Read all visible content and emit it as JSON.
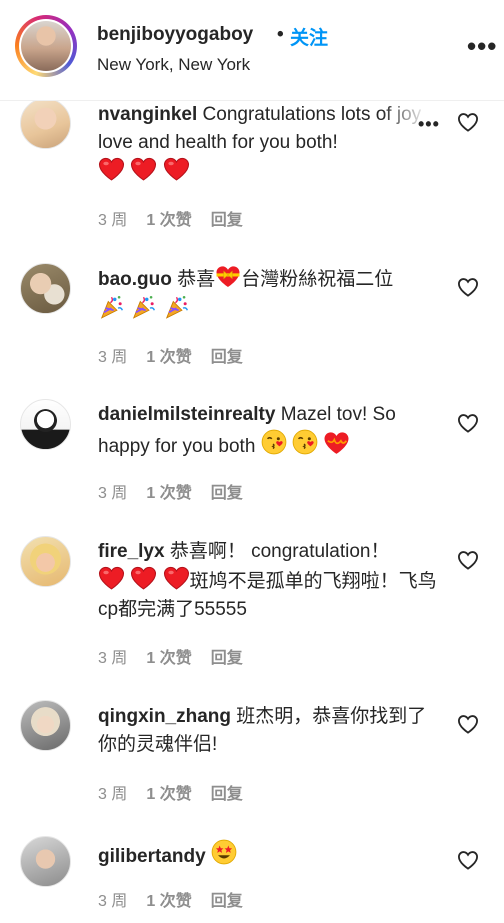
{
  "header": {
    "username": "benjiboyyogaboy",
    "dot": "•",
    "follow_label": "关注",
    "location": "New York, New York",
    "more_icon": "more-horizontal-icon"
  },
  "colors": {
    "follow": "#0095f6",
    "meta": "#8e8e8e",
    "heart_red": "#ed1c24"
  },
  "comments": [
    {
      "username": "nvanginkel",
      "text": "Congratulations lots of joy love and health for you both!",
      "emoji": [
        "red-heart",
        "red-heart",
        "red-heart"
      ],
      "age": "3 周",
      "likes": "1 次赞",
      "reply": "回复"
    },
    {
      "username": "bao.guo",
      "text_before": "恭喜",
      "text_after": "台灣粉絲祝福二位",
      "emoji_inline": [
        "heart-with-ribbon"
      ],
      "emoji": [
        "party-popper",
        "party-popper",
        "party-popper"
      ],
      "age": "3 周",
      "likes": "1 次赞",
      "reply": "回复"
    },
    {
      "username": "danielmilsteinrealty",
      "text": "Mazel tov! So happy for you both",
      "emoji": [
        "face-blowing-kiss",
        "face-blowing-kiss",
        "heart-on-fire"
      ],
      "age": "3 周",
      "likes": "1 次赞",
      "reply": "回复"
    },
    {
      "username": "fire_lyx",
      "text_before": "恭喜啊！ congratulation！",
      "text_after": "斑鸠不是孤单的飞翔啦！飞鸟cp都完满了55555",
      "emoji_inline": [
        "red-heart",
        "red-heart",
        "red-heart"
      ],
      "age": "3 周",
      "likes": "1 次赞",
      "reply": "回复"
    },
    {
      "username": "qingxin_zhang",
      "text": "班杰明，恭喜你找到了你的灵魂伴侣!",
      "age": "3 周",
      "likes": "1 次赞",
      "reply": "回复"
    },
    {
      "username": "gilibertandy",
      "text": "",
      "emoji": [
        "star-struck"
      ],
      "age": "3 周",
      "likes": "1 次赞",
      "reply": "回复"
    }
  ]
}
